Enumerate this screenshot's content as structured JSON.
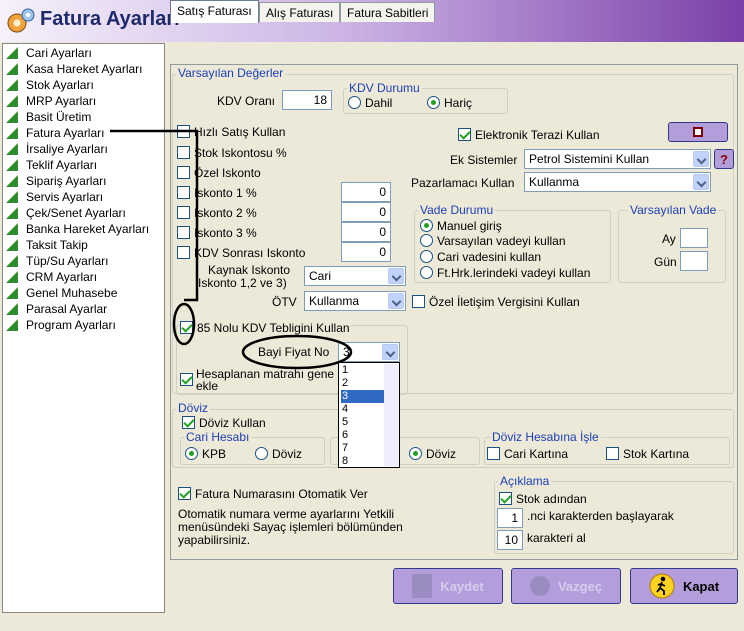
{
  "window": {
    "title": "Fatura Ayarları"
  },
  "sidebar": {
    "items": [
      {
        "label": "Cari Ayarları"
      },
      {
        "label": "Kasa Hareket Ayarları"
      },
      {
        "label": "Stok Ayarları"
      },
      {
        "label": "MRP Ayarları"
      },
      {
        "label": "Basit Üretim"
      },
      {
        "label": "Fatura Ayarları"
      },
      {
        "label": "İrsaliye Ayarları"
      },
      {
        "label": "Teklif Ayarları"
      },
      {
        "label": "Sipariş Ayarları"
      },
      {
        "label": "Servis Ayarları"
      },
      {
        "label": "Çek/Senet Ayarları"
      },
      {
        "label": "Banka Hareket Ayarları"
      },
      {
        "label": "Taksit Takip"
      },
      {
        "label": "Tüp/Su Ayarları"
      },
      {
        "label": "CRM Ayarları"
      },
      {
        "label": "Genel Muhasebe"
      },
      {
        "label": "Parasal Ayarlar"
      },
      {
        "label": "Program Ayarları"
      }
    ]
  },
  "tabs": [
    {
      "label": "Satış Faturası"
    },
    {
      "label": "Alış Faturası"
    },
    {
      "label": "Fatura Sabitleri"
    }
  ],
  "defaults": {
    "legend": "Varsayılan Değerler",
    "kdv_label": "KDV Oranı",
    "kdv_value": "18",
    "kdv_durumu": {
      "legend": "KDV Durumu",
      "dahil": "Dahil",
      "haric": "Hariç",
      "selected": "haric"
    }
  },
  "options": {
    "hizli_satis": {
      "label": "Hızlı Satış Kullan",
      "checked": false
    },
    "stok_iskontosu": {
      "label": "Stok Iskontosu %",
      "checked": false
    },
    "ozel_iskonto": {
      "label": "Özel Iskonto",
      "checked": false
    },
    "iskonto1": {
      "label": "Iskonto 1 %",
      "value": "0",
      "checked": false
    },
    "iskonto2": {
      "label": "Iskonto 2 %",
      "value": "0",
      "checked": false
    },
    "iskonto3": {
      "label": "Iskonto 3 %",
      "value": "0",
      "checked": false
    },
    "kdv_sonrasi": {
      "label": "KDV Sonrası Iskonto",
      "value": "0",
      "checked": false
    },
    "kaynak_iskonto": {
      "label_line1": "Kaynak Iskonto",
      "label_line2": "Iskonto 1,2 ve 3)",
      "value": "Cari"
    },
    "otv": {
      "label": "ÖTV",
      "value": "Kullanma"
    },
    "ozel_iletisim": {
      "label": "Özel İletişim Vergisini Kullan",
      "checked": false
    },
    "kdv_tebligi": {
      "label": "85 Nolu KDV Tebligini Kullan",
      "checked": true
    },
    "bayi_fiyat": {
      "label": "Bayi Fiyat No",
      "value": "3"
    },
    "hesaplanan": {
      "label_line1": "Hesaplanan matrahı gene",
      "label_line2": "ekle",
      "checked": true
    }
  },
  "dropdown": {
    "items": [
      "1",
      "2",
      "3",
      "4",
      "5",
      "6",
      "7",
      "8"
    ],
    "selected": "3"
  },
  "right": {
    "terazi": {
      "label": "Elektronik Terazi Kullan",
      "checked": true
    },
    "ek_sistemler": {
      "label": "Ek Sistemler",
      "value": "Petrol Sistemini Kullan",
      "help": "?"
    },
    "pazarlamaci": {
      "label": "Pazarlamacı Kullan",
      "value": "Kullanma"
    },
    "vade_durumu": {
      "legend": "Vade Durumu",
      "options": [
        "Manuel giriş",
        "Varsayılan vadeyi kullan",
        "Cari vadesini kullan",
        "Ft.Hrk.lerindeki vadeyi kullan"
      ],
      "selected": "Manuel giriş"
    },
    "varsayilan_vade": {
      "legend": "Varsayılan Vade",
      "ay": "Ay",
      "gun": "Gün"
    }
  },
  "doviz": {
    "legend": "Döviz",
    "kullan": {
      "label": "Döviz Kullan",
      "checked": true
    },
    "cari_hesabi": {
      "legend": "Cari Hesabı",
      "kpb": "KPB",
      "doviz": "Döviz",
      "selected": "KPB"
    },
    "mid_doviz": {
      "label": "Döviz",
      "checked": true
    },
    "hesabina_isle": {
      "legend": "Döviz Hesabına İşle",
      "cari": "Cari Kartına",
      "stok": "Stok Kartına"
    }
  },
  "fatura_no": {
    "label": "Fatura Numarasını Otomatik Ver",
    "checked": true,
    "note_line1": "Otomatik numara verme ayarlarını Yetkili",
    "note_line2": "menüsündeki Sayaç işlemleri bölümünden",
    "note_line3": "yapabilirsiniz."
  },
  "aciklama": {
    "legend": "Açıklama",
    "stok_adindan": {
      "label": "Stok adından",
      "checked": true
    },
    "start_value": "1",
    "start_label": ".nci karakterden başlayarak",
    "count_value": "10",
    "count_label": "karakteri al"
  },
  "buttons": {
    "save": "Kaydet",
    "cancel": "Vazgeç",
    "close": "Kapat"
  },
  "colors": {
    "title": "#1f2a6b",
    "legend": "#1c3fb5",
    "check": "#21a121",
    "button_bg": "#b39ddb"
  }
}
